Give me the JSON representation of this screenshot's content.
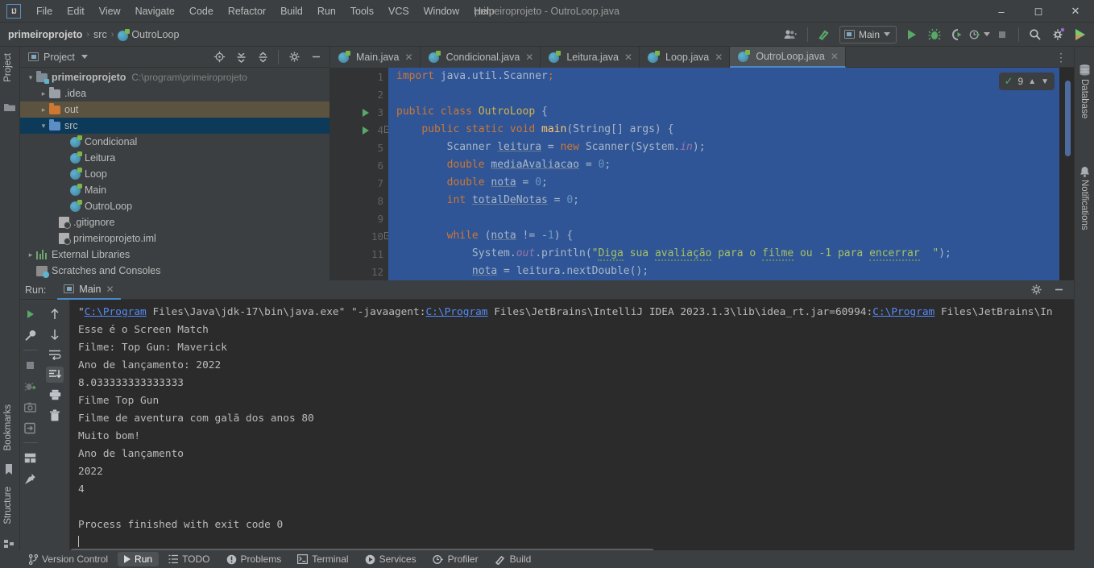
{
  "window": {
    "title": "primeiroprojeto - OutroLoop.java",
    "logo": "ij-logo",
    "minimize": "–",
    "maximize": "❐",
    "close": "✕"
  },
  "menu": {
    "items": [
      "File",
      "Edit",
      "View",
      "Navigate",
      "Code",
      "Refactor",
      "Build",
      "Run",
      "Tools",
      "VCS",
      "Window",
      "Help"
    ]
  },
  "navbar": {
    "breadcrumb": [
      "primeiroprojeto",
      "src",
      "OutroLoop"
    ],
    "separator": "›",
    "run_config": "Main",
    "icons": [
      "user-group-icon",
      "update-project-icon",
      "run-icon",
      "debug-icon",
      "run-with-coverage-icon",
      "profiler-icon",
      "stop-icon",
      "search-icon",
      "settings-icon",
      "ide-assistant-icon"
    ]
  },
  "left_strip": {
    "project_label": "Project",
    "bookmarks_label": "Bookmarks",
    "structure_label": "Structure"
  },
  "right_strip": {
    "database_label": "Database",
    "notifications_label": "Notifications"
  },
  "project_panel": {
    "title": "Project",
    "tools": [
      "select-opened-file-icon",
      "expand-all-icon",
      "collapse-all-icon",
      "settings-icon",
      "hide-icon"
    ],
    "tree": [
      {
        "label": "primeiroprojeto",
        "path": "C:\\program\\primeiroprojeto",
        "indent": 0,
        "arrow": "⌄",
        "icon": "module-folder",
        "bold": true,
        "state": "none"
      },
      {
        "label": ".idea",
        "path": "",
        "indent": 1,
        "arrow": "›",
        "icon": "folder-gray",
        "bold": false,
        "state": "none"
      },
      {
        "label": "out",
        "path": "",
        "indent": 1,
        "arrow": "›",
        "icon": "folder-orange",
        "bold": false,
        "state": "hover"
      },
      {
        "label": "src",
        "path": "",
        "indent": 1,
        "arrow": "⌄",
        "icon": "folder-blue",
        "bold": false,
        "state": "selected"
      },
      {
        "label": "Condicional",
        "path": "",
        "indent": 2,
        "arrow": "",
        "icon": "java-class",
        "bold": false,
        "state": "none"
      },
      {
        "label": "Leitura",
        "path": "",
        "indent": 2,
        "arrow": "",
        "icon": "java-class",
        "bold": false,
        "state": "none"
      },
      {
        "label": "Loop",
        "path": "",
        "indent": 2,
        "arrow": "",
        "icon": "java-class",
        "bold": false,
        "state": "none"
      },
      {
        "label": "Main",
        "path": "",
        "indent": 2,
        "arrow": "",
        "icon": "java-class",
        "bold": false,
        "state": "none"
      },
      {
        "label": "OutroLoop",
        "path": "",
        "indent": 2,
        "arrow": "",
        "icon": "java-class",
        "bold": false,
        "state": "none"
      },
      {
        "label": ".gitignore",
        "path": "",
        "indent": 1,
        "arrow": "",
        "icon": "file-ignored",
        "bold": false,
        "state": "none"
      },
      {
        "label": "primeiroprojeto.iml",
        "path": "",
        "indent": 1,
        "arrow": "",
        "icon": "file-iml",
        "bold": false,
        "state": "none"
      },
      {
        "label": "External Libraries",
        "path": "",
        "indent": 0,
        "arrow": "›",
        "icon": "libraries",
        "bold": false,
        "state": "none"
      },
      {
        "label": "Scratches and Consoles",
        "path": "",
        "indent": 0,
        "arrow": "",
        "icon": "scratches",
        "bold": false,
        "state": "none"
      }
    ]
  },
  "editor": {
    "tabs": [
      {
        "label": "Main.java",
        "active": false
      },
      {
        "label": "Condicional.java",
        "active": false
      },
      {
        "label": "Leitura.java",
        "active": false
      },
      {
        "label": "Loop.java",
        "active": false
      },
      {
        "label": "OutroLoop.java",
        "active": true
      }
    ],
    "close_glyph": "✕",
    "inspection": {
      "count": "9",
      "up": "⌃",
      "down": "⌄",
      "icon": "inspections-ok-icon"
    },
    "line_numbers": [
      "1",
      "2",
      "3",
      "4",
      "5",
      "6",
      "7",
      "8",
      "9",
      "10",
      "11",
      "12"
    ],
    "lines": [
      "import java.util.Scanner;",
      "",
      "public class OutroLoop {",
      "    public static void main(String[] args) {",
      "        Scanner leitura = new Scanner(System.in);",
      "        double mediaAvaliacao = 0;",
      "        double nota = 0;",
      "        int totalDeNotas = 0;",
      "",
      "        while (nota != -1) {",
      "            System.out.println(\"Diga sua avaliação para o filme ou -1 para encerrar  \");",
      "            nota = leitura.nextDouble();"
    ]
  },
  "run_panel": {
    "label": "Run:",
    "tab": "Main",
    "close_glyph": "✕",
    "toolbar_left": [
      "rerun-icon",
      "wrench-icon",
      "stop-icon",
      "debug-thread-icon",
      "camera-icon",
      "export-icon",
      "layout-icon",
      "pin-icon"
    ],
    "toolbar_second": [
      "up-arrow-icon",
      "down-arrow-icon",
      "soft-wrap-icon",
      "scroll-to-end-icon",
      "print-icon",
      "trash-icon"
    ],
    "header_tools": [
      "settings-icon",
      "hide-icon"
    ],
    "console": [
      {
        "text": "\"C:\\Program Files\\Java\\jdk-17\\bin\\java.exe\" \"-javaagent:C:\\Program Files\\JetBrains\\IntelliJ IDEA 2023.1.3\\lib\\idea_rt.jar=60994:C:\\Program Files\\JetBrains\\In",
        "kind": "command"
      },
      {
        "text": "Esse é o Screen Match",
        "kind": "out"
      },
      {
        "text": "Filme: Top Gun: Maverick",
        "kind": "out"
      },
      {
        "text": "Ano de lançamento: 2022",
        "kind": "out"
      },
      {
        "text": "8.033333333333333",
        "kind": "out"
      },
      {
        "text": "Filme Top Gun",
        "kind": "out"
      },
      {
        "text": "Filme de aventura com galã dos anos 80",
        "kind": "out"
      },
      {
        "text": "Muito bom!",
        "kind": "out"
      },
      {
        "text": "Ano de lançamento",
        "kind": "out"
      },
      {
        "text": "2022",
        "kind": "out"
      },
      {
        "text": "4",
        "kind": "out"
      },
      {
        "text": "",
        "kind": "out"
      },
      {
        "text": "Process finished with exit code 0",
        "kind": "out"
      }
    ],
    "link_segments": [
      "C:\\Program",
      "C:\\Program",
      "C:\\Program"
    ]
  },
  "status_bar": {
    "items": [
      {
        "label": "Version Control",
        "icon": "branch-icon",
        "active": false
      },
      {
        "label": "Run",
        "icon": "run-icon",
        "active": true
      },
      {
        "label": "TODO",
        "icon": "todo-icon",
        "active": false
      },
      {
        "label": "Problems",
        "icon": "problems-icon",
        "active": false
      },
      {
        "label": "Terminal",
        "icon": "terminal-icon",
        "active": false
      },
      {
        "label": "Services",
        "icon": "services-icon",
        "active": false
      },
      {
        "label": "Profiler",
        "icon": "profiler-icon",
        "active": false
      },
      {
        "label": "Build",
        "icon": "build-icon",
        "active": false
      }
    ]
  },
  "colors": {
    "accent": "#4a88c7",
    "selection": "#2f5597",
    "keyword": "#cc7832",
    "string": "#a5c261",
    "number": "#6897bb",
    "field": "#9876aa",
    "link": "#548af7",
    "green": "#59a869",
    "panel": "#3c3f41",
    "editor_bg": "#2b2b2b"
  }
}
